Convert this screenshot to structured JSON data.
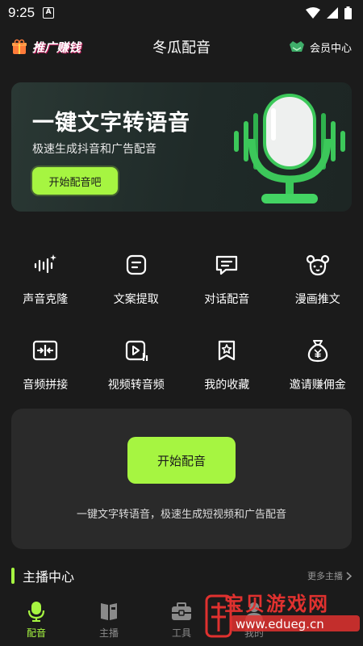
{
  "status_bar": {
    "time": "9:25",
    "notification_letter": "A"
  },
  "header": {
    "promo_label": "推广赚钱",
    "app_title": "冬瓜配音",
    "vip_label": "会员中心"
  },
  "banner": {
    "title": "一键文字转语音",
    "subtitle": "极速生成抖音和广告配音",
    "button_label": "开始配音吧"
  },
  "features": [
    {
      "label": "声音克隆",
      "icon": "voice-clone-icon"
    },
    {
      "label": "文案提取",
      "icon": "text-extract-icon"
    },
    {
      "label": "对话配音",
      "icon": "dialogue-icon"
    },
    {
      "label": "漫画推文",
      "icon": "comic-icon"
    },
    {
      "label": "音频拼接",
      "icon": "audio-join-icon"
    },
    {
      "label": "视频转音频",
      "icon": "video-to-audio-icon"
    },
    {
      "label": "我的收藏",
      "icon": "favorites-icon"
    },
    {
      "label": "邀请赚佣金",
      "icon": "money-bag-icon"
    }
  ],
  "start_panel": {
    "button_label": "开始配音",
    "description": "一键文字转语音，极速生成短视频和广告配音"
  },
  "section": {
    "title": "主播中心",
    "more_label": "更多主播"
  },
  "bottom_nav": [
    {
      "label": "配音",
      "active": true
    },
    {
      "label": "主播",
      "active": false
    },
    {
      "label": "工具",
      "active": false
    },
    {
      "label": "我的",
      "active": false
    }
  ],
  "watermark": {
    "text": "宝贝游戏网",
    "url": "www.edueg.cn"
  },
  "colors": {
    "accent": "#a6f541",
    "background": "#1b1b1b",
    "panel": "#2a2a2a"
  }
}
